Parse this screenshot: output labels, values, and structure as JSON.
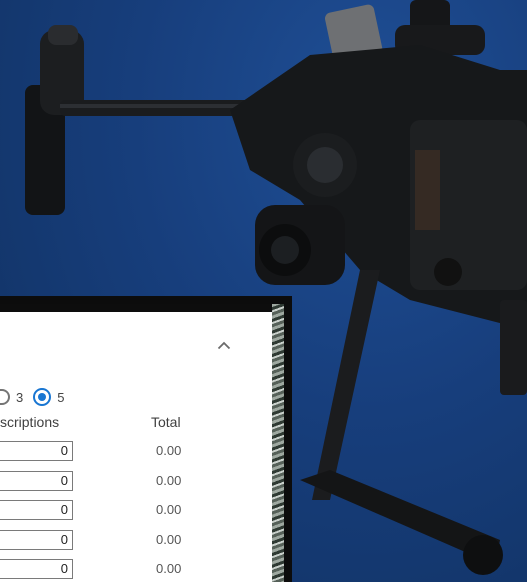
{
  "widget": {
    "radio_options": [
      {
        "label": "3",
        "selected": false
      },
      {
        "label": "5",
        "selected": true
      }
    ],
    "columns": {
      "subscriptions": "scriptions",
      "total": "Total"
    },
    "rows": [
      {
        "quantity": "0",
        "total": "0.00"
      },
      {
        "quantity": "0",
        "total": "0.00"
      },
      {
        "quantity": "0",
        "total": "0.00"
      },
      {
        "quantity": "0",
        "total": "0.00"
      },
      {
        "quantity": "0",
        "total": "0.00"
      }
    ]
  },
  "icons": {
    "collapse": "chevron-up-icon",
    "scroll_up": "scroll-up-arrow-icon"
  },
  "colors": {
    "sky": "#173e7c",
    "radio_selected": "#1976d2",
    "panel_bg": "#ffffff"
  }
}
